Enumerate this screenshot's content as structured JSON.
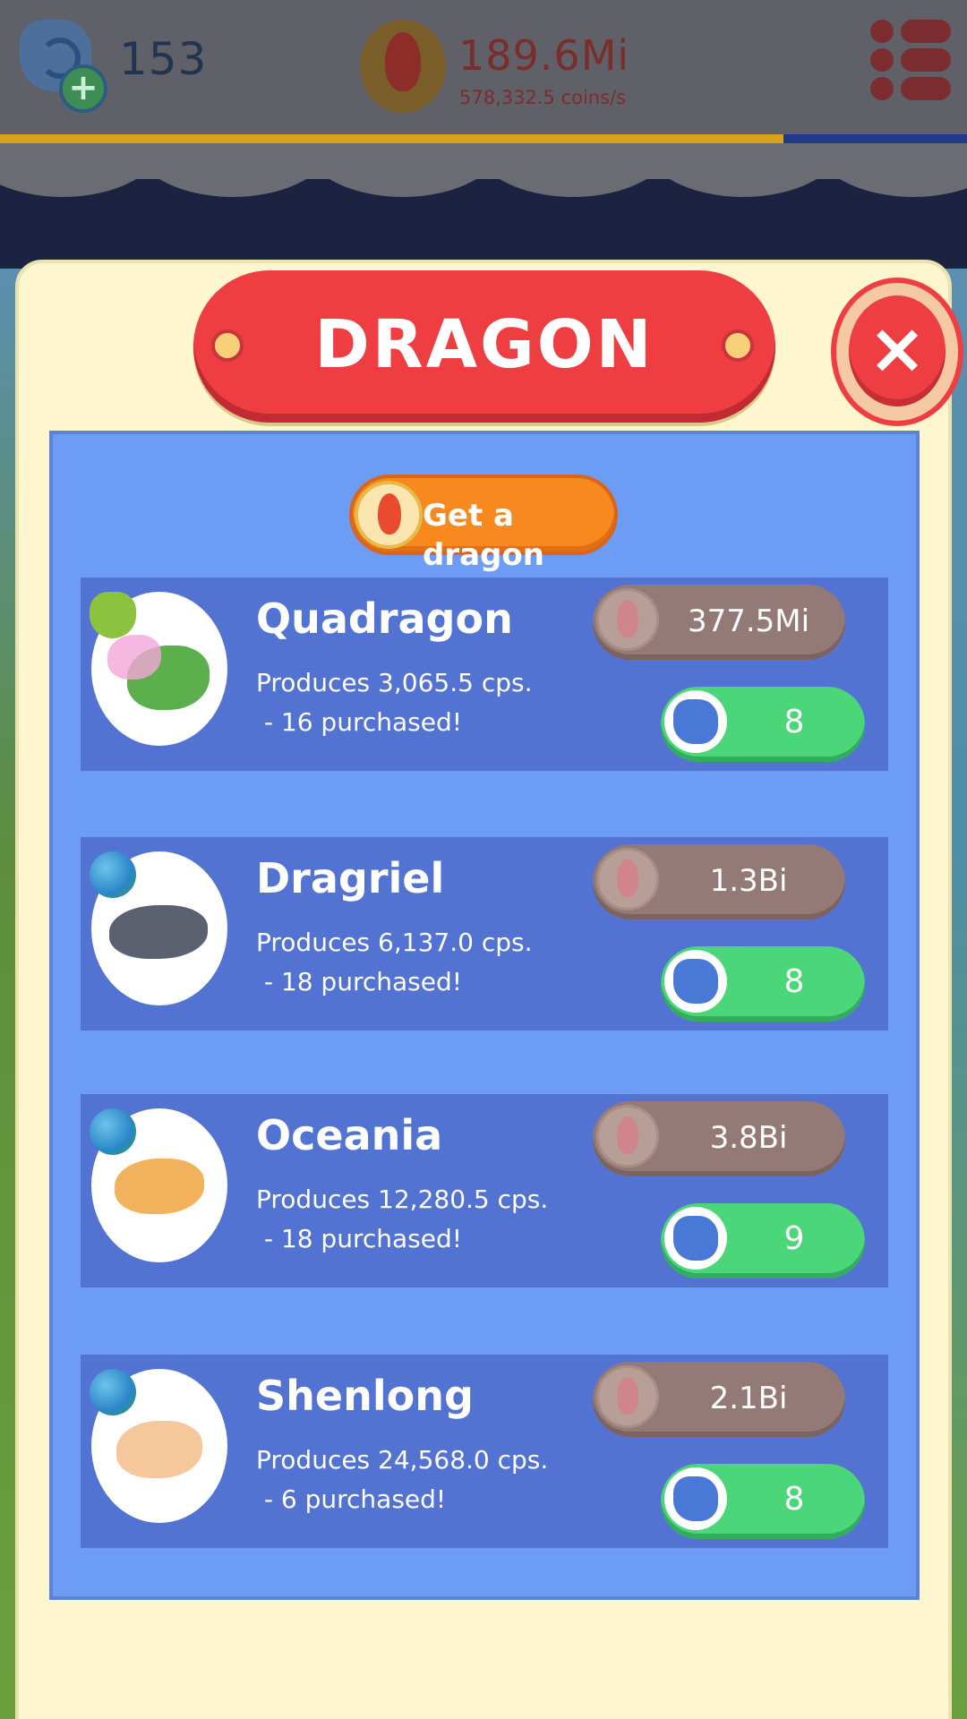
{
  "header": {
    "gems_count": "153",
    "coins_total": "189.6Mi",
    "coins_rate": "578,332.5 coins/s",
    "progress_fraction": 0.81
  },
  "modal": {
    "title": "DRAGON",
    "close_icon": "×",
    "get_dragon_label": "Get a dragon"
  },
  "dragons": [
    {
      "name": "Quadragon",
      "production": "Produces 3,065.5 cps.",
      "purchased": " - 16 purchased!",
      "coin_price": "377.5Mi",
      "gem_price": "8",
      "element_icon": "nature-element-icon"
    },
    {
      "name": "Dragriel",
      "production": "Produces 6,137.0 cps.",
      "purchased": " - 18 purchased!",
      "coin_price": "1.3Bi",
      "gem_price": "8",
      "element_icon": "earth-element-icon"
    },
    {
      "name": "Oceania",
      "production": "Produces 12,280.5 cps.",
      "purchased": " - 18 purchased!",
      "coin_price": "3.8Bi",
      "gem_price": "9",
      "element_icon": "earth-element-icon"
    },
    {
      "name": "Shenlong",
      "production": "Produces 24,568.0 cps.",
      "purchased": " - 6 purchased!",
      "coin_price": "2.1Bi",
      "gem_price": "8",
      "element_icon": "earth-element-icon"
    }
  ],
  "colors": {
    "banner_red": "#ef3e42",
    "panel_blue": "#6d9cf5",
    "card_blue": "#5373d2",
    "coin_pill": "#947a77",
    "gem_pill": "#4cd67a",
    "get_dragon_orange": "#f7891f"
  }
}
